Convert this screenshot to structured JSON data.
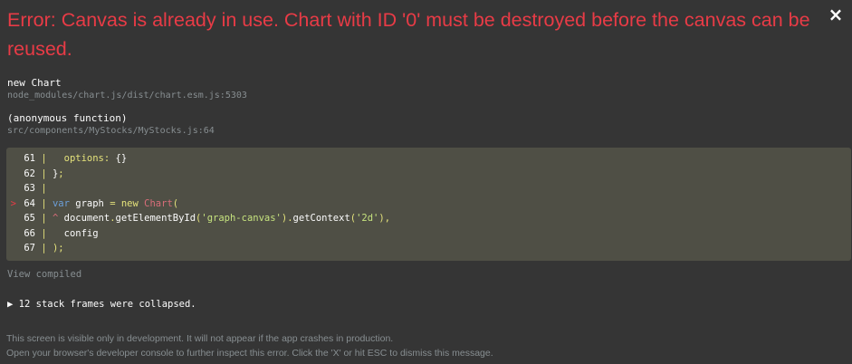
{
  "error": {
    "title": "Error: Canvas is already in use. Chart with ID '0' must be destroyed before the canvas can be reused.",
    "close_label": "×"
  },
  "frames": [
    {
      "function": "new Chart",
      "location": "node_modules/chart.js/dist/chart.esm.js:5303"
    },
    {
      "function": "(anonymous function)",
      "location": "src/components/MyStocks/MyStocks.js:64"
    }
  ],
  "code": {
    "lines": [
      {
        "marker": "",
        "num": "61",
        "text": "options: {}"
      },
      {
        "marker": "",
        "num": "62",
        "text": "};"
      },
      {
        "marker": "",
        "num": "63",
        "text": ""
      },
      {
        "marker": ">",
        "num": "64",
        "text": "var graph = new Chart("
      },
      {
        "marker": "",
        "num": "65",
        "text": "^ document.getElementById('graph-canvas').getContext('2d'),"
      },
      {
        "marker": "",
        "num": "66",
        "text": "config"
      },
      {
        "marker": "",
        "num": "67",
        "text": ");"
      }
    ]
  },
  "view_compiled": "View compiled",
  "collapsed": {
    "arrow": "▶",
    "label": "12 stack frames were collapsed."
  },
  "footer": {
    "line1": "This screen is visible only in development. It will not appear if the app crashes in production.",
    "line2": "Open your browser's developer console to further inspect this error.  Click the 'X' or hit ESC to dismiss this message."
  },
  "colors": {
    "background": "#353535",
    "error_red": "#e83b46",
    "code_background": "#4f4f45",
    "muted_text": "#878e91"
  }
}
